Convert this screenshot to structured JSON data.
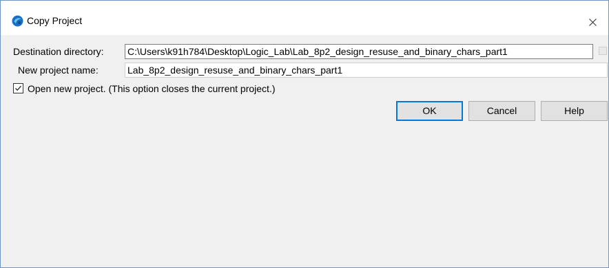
{
  "window": {
    "title": "Copy Project",
    "close_glyph": "×"
  },
  "form": {
    "destination_label": "Destination directory:",
    "destination_value": "C:\\Users\\k91h784\\Desktop\\Logic_Lab\\Lab_8p2_design_resuse_and_binary_chars_part1",
    "project_name_label": "New project name:",
    "project_name_value": "Lab_8p2_design_resuse_and_binary_chars_part1",
    "open_project_label": "Open new project. (This option closes the current project.)",
    "open_project_checked": true
  },
  "buttons": {
    "ok": "OK",
    "cancel": "Cancel",
    "help": "Help"
  },
  "icons": {
    "app": "quartus-app-icon",
    "close": "close-icon",
    "check": "checkmark-icon"
  },
  "colors": {
    "accent": "#0078d7",
    "border": "#6e93c7"
  }
}
